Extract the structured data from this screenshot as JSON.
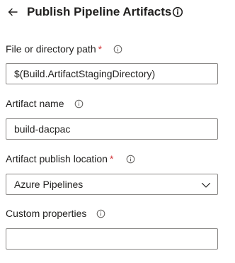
{
  "header": {
    "back_icon": "arrow-left-icon",
    "title": "Publish Pipeline Artifacts",
    "info_icon": "info-circle-icon"
  },
  "fields": {
    "path": {
      "label": "File or directory path",
      "required_marker": "*",
      "value": "$(Build.ArtifactStagingDirectory)"
    },
    "artifact_name": {
      "label": "Artifact name",
      "value": "build-dacpac"
    },
    "publish_location": {
      "label": "Artifact publish location",
      "required_marker": "*",
      "selected": "Azure Pipelines"
    },
    "custom_properties": {
      "label": "Custom properties",
      "value": ""
    }
  },
  "colors": {
    "required": "#d13438",
    "input_border": "#8a8886",
    "text": "#201f1e"
  }
}
